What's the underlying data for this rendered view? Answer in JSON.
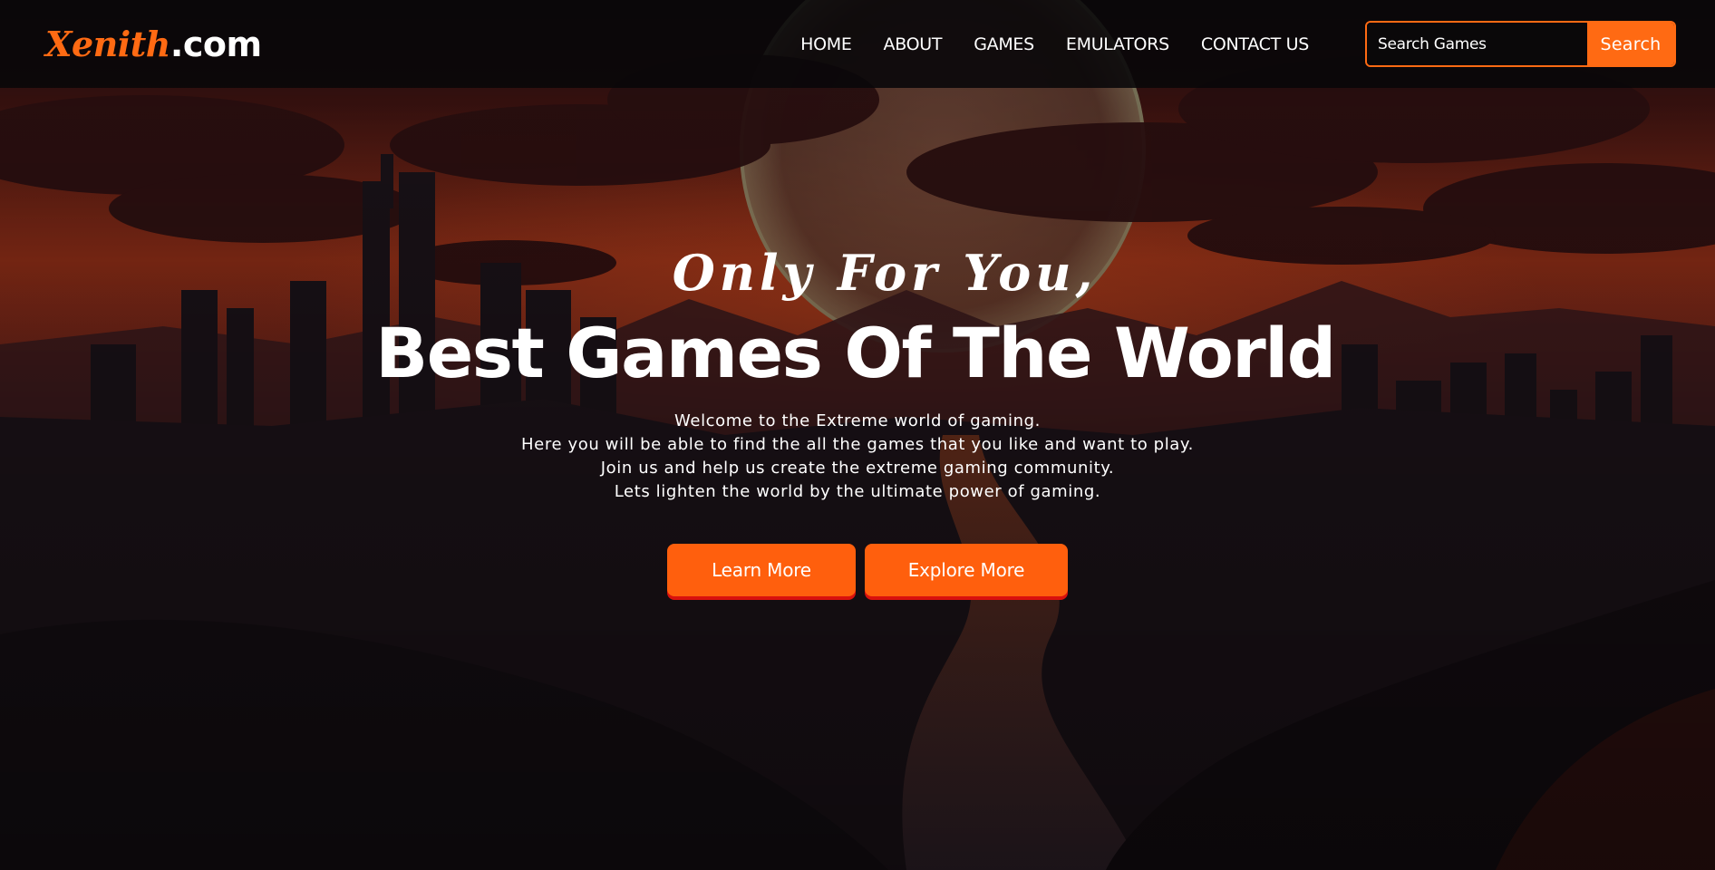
{
  "logo": {
    "brand": "Xenith",
    "tld": ".com"
  },
  "nav": {
    "links": [
      {
        "label": "HOME"
      },
      {
        "label": "ABOUT"
      },
      {
        "label": "GAMES"
      },
      {
        "label": "EMULATORS"
      },
      {
        "label": "CONTACT US"
      }
    ]
  },
  "search": {
    "placeholder": "Search Games",
    "value": "",
    "button_label": "Search"
  },
  "hero": {
    "tagline": "Only For You,",
    "title": "Best Games Of The World",
    "description_lines": [
      "Welcome to the Extreme world of gaming.",
      "Here you will be able to find the all the games that you like and want to play.",
      "Join us and help us create the extreme gaming community.",
      "Lets lighten the world by the ultimate power of gaming."
    ],
    "buttons": {
      "learn_more": "Learn More",
      "explore_more": "Explore More"
    }
  },
  "colors": {
    "accent": "#ff6a13",
    "button_shadow": "#d9110d",
    "navbar_bg": "#080709",
    "sky": "#7a2414"
  }
}
